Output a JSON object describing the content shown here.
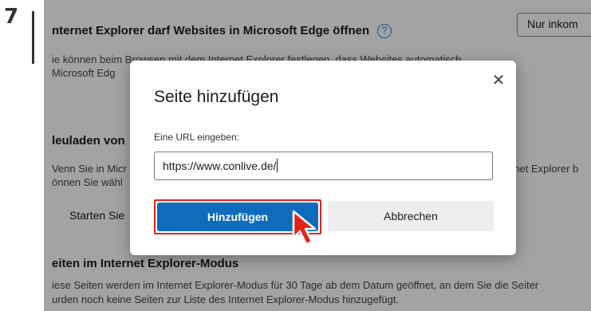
{
  "step": {
    "number": "7"
  },
  "settings": {
    "ie_title": "nternet Explorer darf Websites in Microsoft Edge öffnen",
    "ie_help": "?",
    "ie_desc_line1": "ie können beim Browsen mit dem Internet Explorer festlegen, dass Websites automatisch",
    "ie_desc_line2": "Microsoft Edg",
    "ie_dropdown_value": "Nur inkom",
    "reload_title": "leuladen von",
    "reload_desc_line1": "Venn Sie in Micr",
    "reload_desc_line2": "önnen Sie wähl",
    "reload_desc_right": "rnet Explorer b",
    "start_label": "Starten Sie",
    "pages_title": "eiten im Internet Explorer-Modus",
    "pages_desc_line1": "iese Seiten werden im Internet Explorer-Modus für 30 Tage ab dem Datum geöffnet, an dem Sie die Seiter",
    "pages_desc_line2": "urden noch keine Seiten zur Liste des Internet Explorer-Modus hinzugefügt."
  },
  "dialog": {
    "title": "Seite hinzufügen",
    "close_glyph": "✕",
    "url_label": "Eine URL eingeben:",
    "url_value": "https://www.conlive.de/",
    "add_label": "Hinzufügen",
    "cancel_label": "Abbrechen"
  },
  "colors": {
    "primary": "#0f6cbd",
    "highlight": "#e2231a",
    "overlay": "rgba(0,0,0,0.36)"
  },
  "icons": {
    "help": "help-circle-icon",
    "close": "close-icon",
    "cursor": "arrow-cursor-icon"
  }
}
